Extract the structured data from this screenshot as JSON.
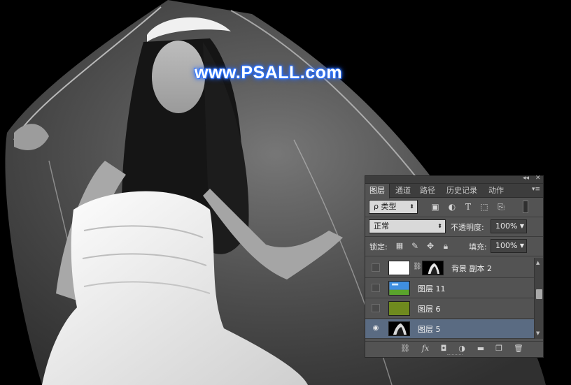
{
  "watermark": "www.PSALL.com",
  "panel": {
    "collapse_glyph": "◂◂",
    "close_glyph": "✕",
    "tabs": [
      {
        "label": "图层",
        "active": true
      },
      {
        "label": "通道",
        "active": false
      },
      {
        "label": "路径",
        "active": false
      },
      {
        "label": "历史记录",
        "active": false
      },
      {
        "label": "动作",
        "active": false
      }
    ],
    "menu_glyph": "▾≡",
    "filter": {
      "kind_label": "ρ 类型",
      "icons": [
        "image-filter-icon",
        "adjustment-filter-icon",
        "type-filter-icon",
        "shape-filter-icon",
        "smart-object-filter-icon"
      ],
      "type_glyph": "T"
    },
    "blend_mode": "正常",
    "opacity_label": "不透明度:",
    "opacity_value": "100%",
    "lock_label": "锁定:",
    "fill_label": "填充:",
    "fill_value": "100%",
    "layers": [
      {
        "name": "背景 副本 2",
        "visible": false,
        "selected": false,
        "has_mask": true
      },
      {
        "name": "图层 11",
        "visible": false,
        "selected": false,
        "has_mask": false
      },
      {
        "name": "图层 6",
        "visible": false,
        "selected": false,
        "has_mask": false
      },
      {
        "name": "图层 5",
        "visible": true,
        "selected": true,
        "has_mask": false
      }
    ],
    "eye_glyph": "◉",
    "link_glyph": "⛓",
    "footer_icons": [
      "link-layers-icon",
      "fx-icon",
      "add-mask-icon",
      "adjustment-layer-icon",
      "new-group-icon",
      "new-layer-icon",
      "delete-layer-icon"
    ],
    "fx_label": "fx",
    "colors": {
      "panel_bg": "#535353",
      "selected_row": "#5a6b82",
      "green_fill": "#6f8a1e"
    }
  }
}
